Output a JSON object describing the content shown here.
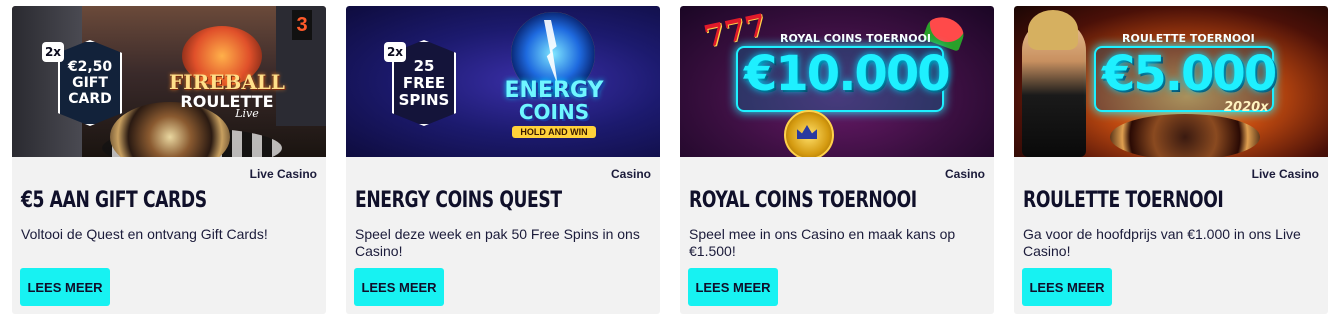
{
  "cards": [
    {
      "category": "Live Casino",
      "title": "€5 AAN GIFT CARDS",
      "description": "Voltooi de Quest en ontvang Gift Cards!",
      "button": "LEES MEER",
      "banner": {
        "multiplier": "2x",
        "badge_line1": "€2,50",
        "badge_line2": "GIFT",
        "badge_line3": "CARD",
        "logo_line1": "FIREBALL",
        "logo_line2": "ROULETTE",
        "logo_line3": "Live"
      }
    },
    {
      "category": "Casino",
      "title": "ENERGY COINS QUEST",
      "description": "Speel deze week en pak 50 Free Spins in ons Casino!",
      "button": "LEES MEER",
      "banner": {
        "multiplier": "2x",
        "badge_line1": "25",
        "badge_line2": "FREE",
        "badge_line3": "SPINS",
        "logo_line1": "ENERGY",
        "logo_line2": "COINS",
        "logo_line3": "HOLD AND WIN"
      }
    },
    {
      "category": "Casino",
      "title": "ROYAL COINS TOERNOOI",
      "description": "Speel mee in ons Casino en maak kans op €1.500!",
      "button": "LEES MEER",
      "banner": {
        "heading": "ROYAL COINS TOERNOOI",
        "amount": "€10.000",
        "sevens": "777"
      }
    },
    {
      "category": "Live Casino",
      "title": "ROULETTE TOERNOOI",
      "description": "Ga voor de hoofdprijs van €1.000 in ons Live Casino!",
      "button": "LEES MEER",
      "banner": {
        "heading": "ROULETTE TOERNOOI",
        "amount": "€5.000",
        "multiplier": "2020x"
      }
    }
  ]
}
